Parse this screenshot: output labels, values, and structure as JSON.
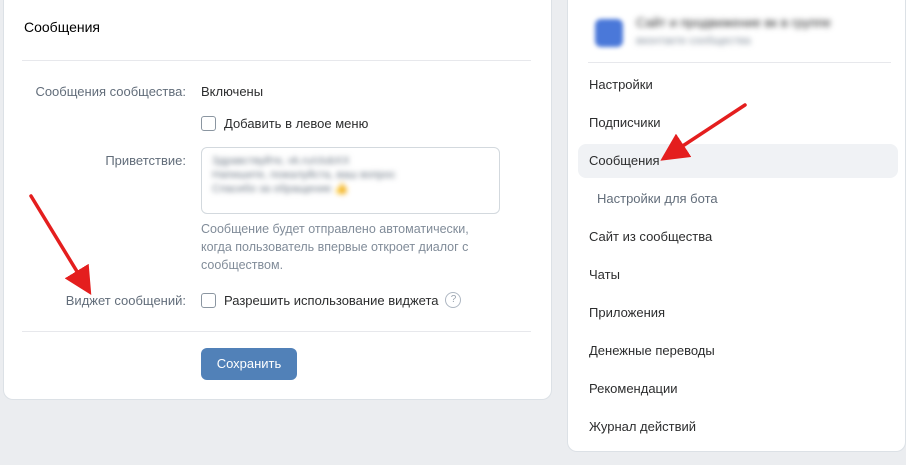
{
  "left": {
    "title": "Сообщения",
    "messages_label": "Сообщения сообщества:",
    "messages_value": "Включены",
    "add_to_menu_label": "Добавить в левое меню",
    "greeting_label": "Приветствие:",
    "greeting_text": "Здравствуйте, vk.ru/clubXX\nНапишите, пожалуйста, ваш вопрос\nСпасибо за обращение 👍",
    "hint_text": "Сообщение будет отправлено автоматически, когда пользователь впервые откроет диалог с сообществом.",
    "widget_label": "Виджет сообщений:",
    "widget_checkbox_label": "Разрешить использование виджета",
    "help_icon_glyph": "?",
    "save_label": "Сохранить"
  },
  "right": {
    "community_name": "Сайт и продвижение вк в группе",
    "community_sub": "вконтакте сообщества",
    "menu": [
      {
        "label": "Настройки"
      },
      {
        "label": "Подписчики"
      },
      {
        "label": "Сообщения"
      },
      {
        "label": "Настройки для бота"
      },
      {
        "label": "Сайт из сообщества"
      },
      {
        "label": "Чаты"
      },
      {
        "label": "Приложения"
      },
      {
        "label": "Денежные переводы"
      },
      {
        "label": "Рекомендации"
      },
      {
        "label": "Журнал действий"
      }
    ]
  },
  "colors": {
    "accent": "#5181b8",
    "annotation_arrow": "#e41e1e"
  }
}
